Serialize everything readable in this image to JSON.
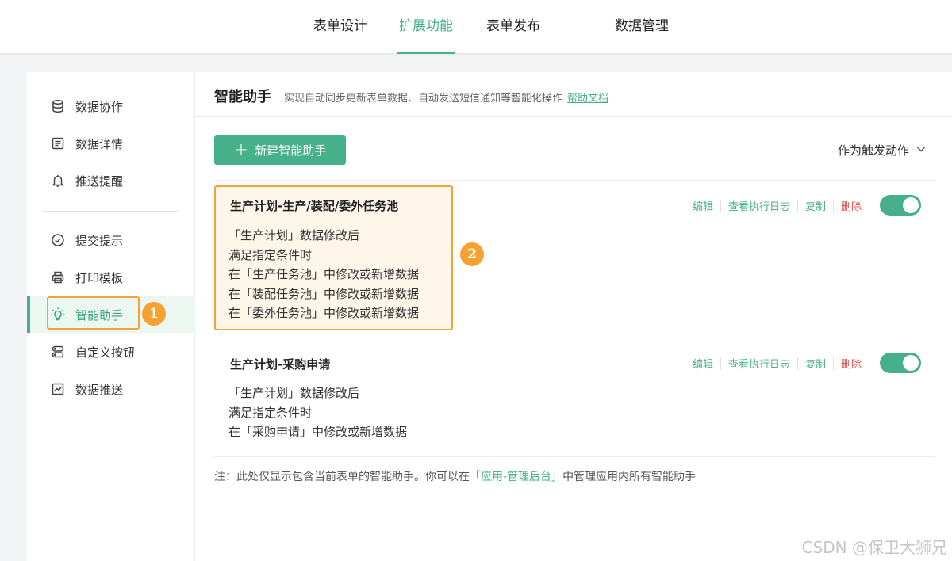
{
  "topnav": {
    "tabs": [
      {
        "label": "表单设计"
      },
      {
        "label": "扩展功能"
      },
      {
        "label": "表单发布"
      },
      {
        "label": "数据管理"
      }
    ],
    "active_tab": "扩展功能"
  },
  "sidebar": {
    "items": [
      {
        "label": "数据协作",
        "icon": "database-icon"
      },
      {
        "label": "数据详情",
        "icon": "document-icon"
      },
      {
        "label": "推送提醒",
        "icon": "bell-icon"
      },
      {
        "label": "提交提示",
        "icon": "check-circle-icon"
      },
      {
        "label": "打印模板",
        "icon": "printer-icon"
      },
      {
        "label": "智能助手",
        "icon": "lightbulb-icon"
      },
      {
        "label": "自定义按钮",
        "icon": "buttons-icon"
      },
      {
        "label": "数据推送",
        "icon": "chart-icon"
      }
    ],
    "active_item": "智能助手"
  },
  "annotations": {
    "one": "1",
    "two": "2"
  },
  "main": {
    "title": "智能助手",
    "description": "实现自动同步更新表单数据、自动发送短信通知等智能化操作",
    "help_link": "帮助文档",
    "new_button": "新建智能助手",
    "trigger_filter": "作为触发动作",
    "cards": [
      {
        "title": "生产计划-生产/装配/委外任务池",
        "lines": [
          "「生产计划」数据修改后",
          "满足指定条件时",
          "在「生产任务池」中修改或新增数据",
          "在「装配任务池」中修改或新增数据",
          "在「委外任务池」中修改或新增数据"
        ],
        "enabled": true
      },
      {
        "title": "生产计划-采购申请",
        "lines": [
          "「生产计划」数据修改后",
          "满足指定条件时",
          "在「采购申请」中修改或新增数据"
        ],
        "enabled": true
      }
    ],
    "actions": {
      "edit": "编辑",
      "log": "查看执行日志",
      "copy": "复制",
      "delete": "删除"
    },
    "note": {
      "prefix": "注：此处仅显示包含当前表单的智能助手。你可以在",
      "highlight": "「应用-管理后台」",
      "suffix": "中管理应用内所有智能助手"
    }
  },
  "watermark": "CSDN @保卫大狮兄",
  "colors": {
    "accent": "#46b08b",
    "annotation": "#f5a230",
    "danger": "#e24a4a"
  }
}
